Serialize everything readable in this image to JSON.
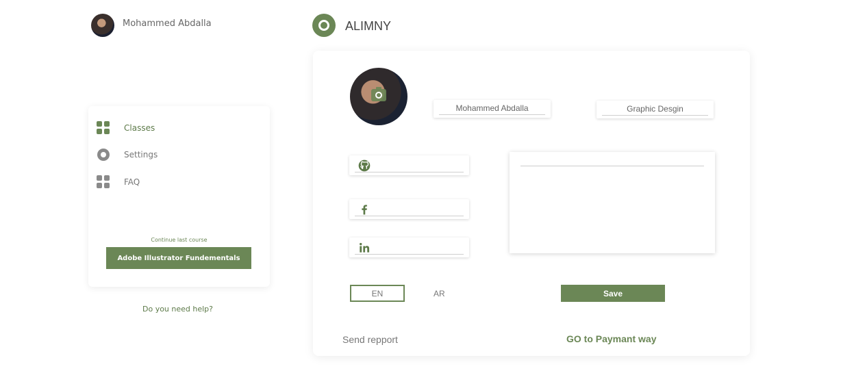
{
  "user": {
    "name": "Mohammed Abdalla"
  },
  "brand": {
    "name": "ALIMNY"
  },
  "sidebar": {
    "items": [
      {
        "label": "Classes",
        "icon": "grid-icon",
        "active": true
      },
      {
        "label": "Settings",
        "icon": "gear-icon",
        "active": false
      },
      {
        "label": "FAQ",
        "icon": "grid-icon",
        "active": false
      }
    ],
    "continue_caption": "Continue last course",
    "course_button": "Adobe Illustrator Fundementals",
    "help_link": "Do you need help?"
  },
  "profile": {
    "name_value": "Mohammed Abdalla",
    "title_value": "Graphic Desgin",
    "social": [
      {
        "icon": "github-icon",
        "value": ""
      },
      {
        "icon": "facebook-icon",
        "value": ""
      },
      {
        "icon": "linkedin-icon",
        "value": ""
      }
    ],
    "bio_value": ""
  },
  "language": {
    "en": "EN",
    "ar": "AR",
    "selected": "EN"
  },
  "actions": {
    "save": "Save",
    "report": "Send repport",
    "payment": "GO to Paymant way"
  },
  "colors": {
    "accent": "#6b8756",
    "active_text": "#5d7a49",
    "inactive_icon": "#8a8a8a",
    "text": "#666666"
  }
}
